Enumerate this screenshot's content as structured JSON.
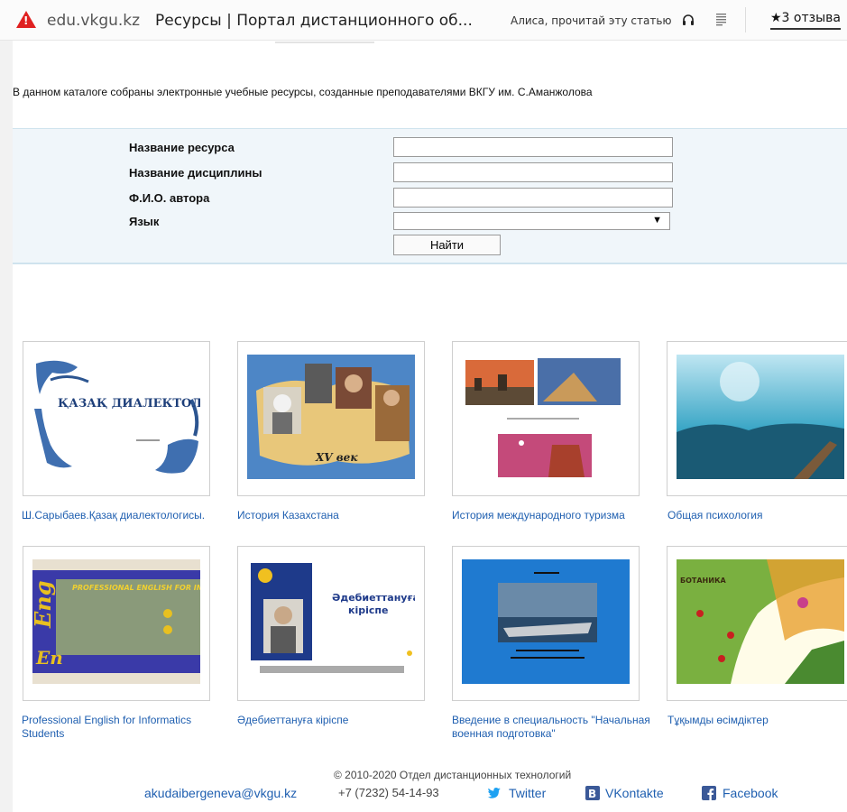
{
  "browser": {
    "domain": "edu.vkgu.kz",
    "page_title": "Ресурсы | Портал дистанционного об...",
    "alice_label": "Алиса, прочитай эту статью",
    "reviews_label": "★3 отзыва"
  },
  "intro": {
    "text": "В данном каталоге собраны электронные учебные ресурсы, созданные преподавателями ВКГУ им. С.Аманжолова"
  },
  "search": {
    "resource_name_label": "Название ресурса",
    "discipline_label": "Название дисциплины",
    "author_label": "Ф.И.О. автора",
    "language_label": "Язык",
    "resource_name_value": "",
    "discipline_value": "",
    "author_value": "",
    "language_value": "",
    "find_button": "Найти"
  },
  "resources": [
    {
      "title": "Ш.Сарыбаев.Қазақ диалектологисы.",
      "thumb_text": "ҚАЗАҚ ДИАЛЕКТОЛОГИЯСЫ"
    },
    {
      "title": "История Казахстана",
      "thumb_text": "XV век"
    },
    {
      "title": "История международного туризма",
      "thumb_text": ""
    },
    {
      "title": "Общая психология",
      "thumb_text": ""
    },
    {
      "title": "Professional English for Informatics Students",
      "thumb_text": "PROFESSIONAL ENGLISH FOR INFORMATICS STUDENTS"
    },
    {
      "title": "Әдебиеттануға кіріспе",
      "thumb_text": "Әдебиеттануға кіріспе"
    },
    {
      "title": "Введение в специальность \"Начальная военная подготовка\"",
      "thumb_text": ""
    },
    {
      "title": "Тұқымды өсімдіктер",
      "thumb_text": "БОТАНИКА"
    }
  ],
  "footer": {
    "copyright": "© 2010-2020  Отдел дистанционных технологий",
    "email": "akudaibergeneva@vkgu.kz",
    "phone": "+7 (7232) 54-14-93",
    "twitter": "Twitter",
    "vkontakte": "VKontakte",
    "facebook": "Facebook"
  },
  "colors": {
    "link": "#1f5fb0",
    "search_bg": "#f0f6fa",
    "yandex_red": "#e02020"
  }
}
